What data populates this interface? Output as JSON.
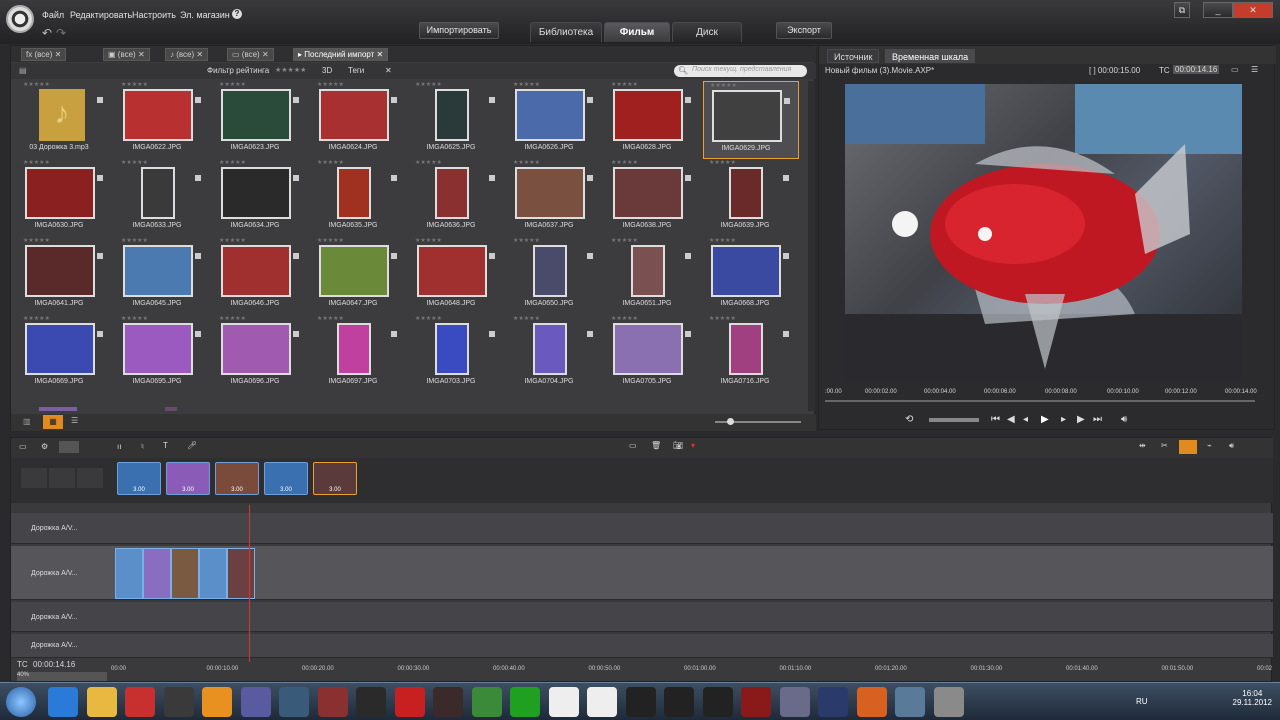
{
  "menu": [
    "Файл",
    "Редактировать",
    "Настроить",
    "Эл. магазин"
  ],
  "toolbar": {
    "import": "Импортировать",
    "export": "Экспорт"
  },
  "tabs": [
    "Библиотека",
    "Фильм",
    "Диск"
  ],
  "library": {
    "tabs": [
      "(все)",
      "(все)",
      "(все)",
      "(все)",
      "Последний импорт"
    ],
    "rating_filter": "Фильтр рейтинга",
    "three_d": "3D",
    "tags": "Теги",
    "search_placeholder": "Поиск текущ. представления",
    "items": [
      [
        "03 Дорожка 3.mp3",
        "IMGA0622.JPG",
        "IMGA0623.JPG",
        "IMGA0624.JPG",
        "IMGA0625.JPG",
        "IMGA0626.JPG",
        "IMGA0628.JPG",
        "IMGA0629.JPG"
      ],
      [
        "IMGA0630.JPG",
        "IMGA0633.JPG",
        "IMGA0634.JPG",
        "IMGA0635.JPG",
        "IMGA0636.JPG",
        "IMGA0637.JPG",
        "IMGA0638.JPG",
        "IMGA0639.JPG"
      ],
      [
        "IMGA0641.JPG",
        "IMGA0645.JPG",
        "IMGA0646.JPG",
        "IMGA0647.JPG",
        "IMGA0648.JPG",
        "IMGA0650.JPG",
        "IMGA0651.JPG",
        "IMGA0668.JPG"
      ],
      [
        "IMGA0669.JPG",
        "IMGA0695.JPG",
        "IMGA0696.JPG",
        "IMGA0697.JPG",
        "IMGA0703.JPG",
        "IMGA0704.JPG",
        "IMGA0705.JPG",
        "IMGA0716.JPG"
      ]
    ]
  },
  "preview": {
    "tab_source": "Источник",
    "tab_timeline": "Временная шкала",
    "movie_name": "Новый фильм (3).Movie.AXP*",
    "duration": "[ ] 00:00:15.00",
    "tc_label": "TC",
    "tc_value": "00:00:14.16",
    "ruler": [
      ":00.00",
      "00:00:02.00",
      "00:00:04.00",
      "00:00:06.00",
      "00:00:08.00",
      "00:00:10.00",
      "00:00:12.00",
      "00:00:14.00"
    ]
  },
  "timeline": {
    "storyboard_durations": [
      "3.00",
      "3.00",
      "3.00",
      "3.00",
      "3.00"
    ],
    "tracks": [
      "Дорожка A/V...",
      "Дорожка A/V...",
      "Дорожка A/V...",
      "Дорожка A/V..."
    ],
    "tc_label": "TC",
    "tc_value": "00:00:14.16",
    "zoom": "40%",
    "ruler": [
      "00:00",
      "00:00:10.00",
      "00:00:20.00",
      "00:00:30.00",
      "00:00:40.00",
      "00:00:50.00",
      "00:01:00.00",
      "00:01:10.00",
      "00:01:20.00",
      "00:01:30.00",
      "00:01:40.00",
      "00:01:50.00",
      "00:02"
    ]
  },
  "taskbar": {
    "lang": "RU",
    "time": "16:04",
    "date": "29.11.2012"
  }
}
